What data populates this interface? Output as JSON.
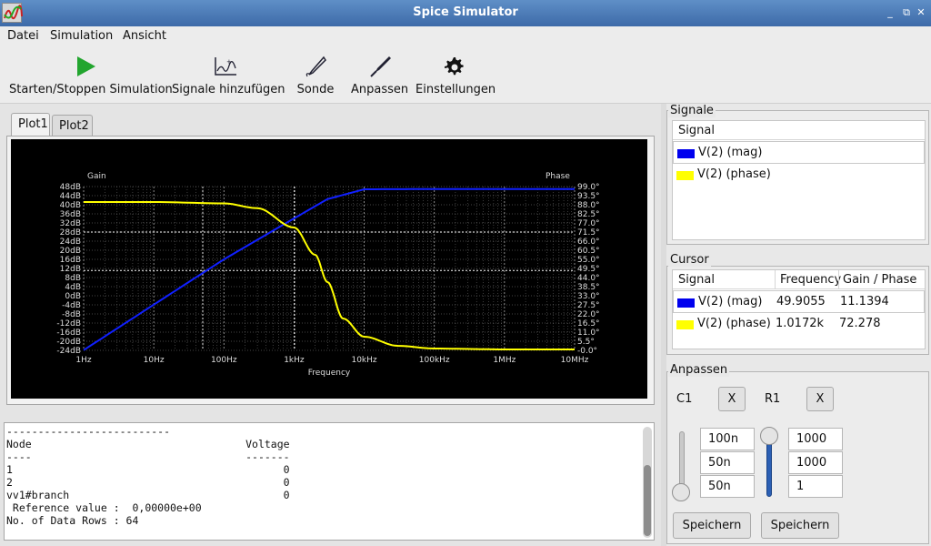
{
  "window": {
    "title": "Spice Simulator",
    "min": "_",
    "max": "⧉",
    "close": "✕"
  },
  "menu": [
    "Datei",
    "Simulation",
    "Ansicht"
  ],
  "toolbar": [
    {
      "label": "Starten/Stoppen Simulation",
      "icon": "play-icon"
    },
    {
      "label": "Signale hinzufügen",
      "icon": "add-signal-icon"
    },
    {
      "label": "Sonde",
      "icon": "probe-icon"
    },
    {
      "label": "Anpassen",
      "icon": "tune-icon"
    },
    {
      "label": "Einstellungen",
      "icon": "gear-icon"
    }
  ],
  "tabs": [
    "Plot1",
    "Plot2"
  ],
  "chart_data": {
    "type": "line",
    "xlabel": "Frequency",
    "ylabel_left": "Gain",
    "ylabel_right": "Phase",
    "x_scale": "log",
    "x_ticks": [
      "1Hz",
      "10Hz",
      "100Hz",
      "1kHz",
      "10kHz",
      "100kHz",
      "1MHz",
      "10MHz"
    ],
    "xlim": [
      1,
      10000000
    ],
    "y_left_ticks": [
      "48dB",
      "44dB",
      "40dB",
      "36dB",
      "32dB",
      "28dB",
      "24dB",
      "20dB",
      "16dB",
      "12dB",
      "8dB",
      "4dB",
      "0dB",
      "-4dB",
      "-8dB",
      "-12dB",
      "-16dB",
      "-20dB",
      "-24dB"
    ],
    "ylim_left": [
      -24,
      48
    ],
    "y_right_ticks": [
      "99.0°",
      "93.5°",
      "88.0°",
      "82.5°",
      "77.0°",
      "71.5°",
      "66.0°",
      "60.5°",
      "55.0°",
      "49.5°",
      "44.0°",
      "38.5°",
      "33.0°",
      "27.5°",
      "22.0°",
      "16.5°",
      "11.0°",
      "5.5°",
      "-0.0°"
    ],
    "ylim_right": [
      0,
      99
    ],
    "grid": true,
    "series": [
      {
        "name": "V(2) (mag)",
        "color": "#1020ff",
        "axis": "left",
        "x": [
          1,
          10,
          100,
          1000,
          3000,
          10000,
          100000,
          1000000,
          10000000
        ],
        "y": [
          -23.9,
          -3.9,
          16.0,
          34.0,
          42.5,
          46.8,
          46.9,
          46.9,
          46.9
        ]
      },
      {
        "name": "V(2) (phase)",
        "color": "#ffff00",
        "axis": "left",
        "x": [
          1,
          10,
          100,
          300,
          1000,
          2000,
          3000,
          5000,
          10000,
          30000,
          100000,
          1000000,
          10000000
        ],
        "y": [
          41.2,
          41.2,
          40.6,
          38.5,
          30.0,
          18.0,
          6.0,
          -10.0,
          -18.0,
          -22.0,
          -23.2,
          -23.6,
          -23.6
        ]
      }
    ]
  },
  "console": {
    "lines": [
      "--------------------------",
      "Node                                  Voltage",
      "----                                  -------",
      "1                                           0",
      "2                                           0",
      "vv1#branch                                  0",
      " Reference value :  0,00000e+00",
      "No. of Data Rows : 64"
    ]
  },
  "signals": {
    "title": "Signale",
    "header": "Signal",
    "items": [
      {
        "label": "V(2) (mag)",
        "color": "#0000ee"
      },
      {
        "label": "V(2) (phase)",
        "color": "#ffff00"
      }
    ]
  },
  "cursor": {
    "title": "Cursor",
    "headers": [
      "Signal",
      "Frequency",
      "Gain / Phase"
    ],
    "rows": [
      {
        "signal": "V(2) (mag)",
        "color": "#0000ee",
        "freq": "49.9055",
        "value": "11.1394"
      },
      {
        "signal": "V(2) (phase)",
        "color": "#ffff00",
        "freq": "1.0172k",
        "value": "72.278"
      }
    ]
  },
  "tune": {
    "title": "Anpassen",
    "c1": {
      "name": "C1",
      "remove": "X",
      "max": "100n",
      "value": "50n",
      "min": "50n",
      "slider_level": 0.0,
      "save": "Speichern"
    },
    "r1": {
      "name": "R1",
      "remove": "X",
      "max": "1000",
      "value": "1000",
      "min": "1",
      "slider_level": 1.0,
      "save": "Speichern"
    }
  }
}
